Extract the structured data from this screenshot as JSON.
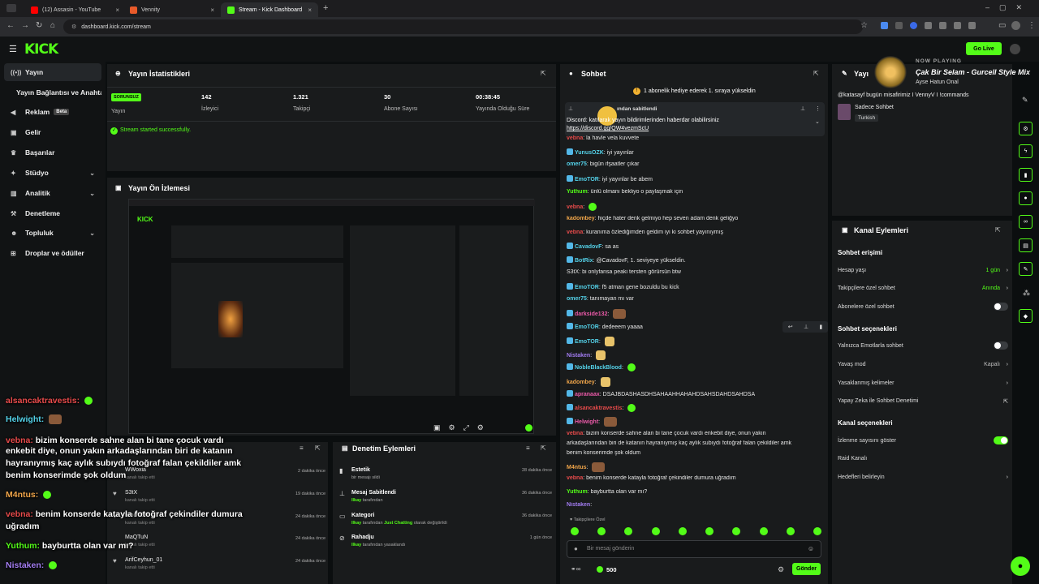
{
  "browser": {
    "tabs": [
      {
        "label": "(12) Assasin - YouTube",
        "color": "#ff0000"
      },
      {
        "label": "Vennity",
        "color": "#e85a2a"
      },
      {
        "label": "Stream - Kick Dashboard",
        "color": "#53fc18"
      }
    ],
    "url": "dashboard.kick.com/stream"
  },
  "nav": {
    "logo": "KICK",
    "golive": "Go Live"
  },
  "sidebar": {
    "items": [
      {
        "label": "Yayın",
        "icon": "broadcast-icon"
      },
      {
        "label": "Yayın Bağlantısı ve Anahtarı"
      },
      {
        "label": "Reklam",
        "badge": "Beta",
        "icon": "megaphone-icon"
      },
      {
        "label": "Gelir",
        "icon": "money-icon"
      },
      {
        "label": "Başarılar",
        "icon": "trophy-icon"
      },
      {
        "label": "Stüdyo",
        "icon": "studio-icon"
      },
      {
        "label": "Analitik",
        "icon": "chart-icon"
      },
      {
        "label": "Denetleme",
        "icon": "hammer-icon"
      },
      {
        "label": "Topluluk",
        "icon": "users-icon"
      },
      {
        "label": "Droplar ve ödüller",
        "icon": "gift-icon"
      }
    ]
  },
  "stats": {
    "title": "Yayın İstatistikleri",
    "badge": "SORUNSUZ",
    "items": [
      {
        "value": "",
        "label": "Yayın"
      },
      {
        "value": "142",
        "label": "İzleyici"
      },
      {
        "value": "1.321",
        "label": "Takipçi"
      },
      {
        "value": "30",
        "label": "Abone Sayısı"
      },
      {
        "value": "00:38:45",
        "label": "Yayında Olduğu Süre"
      }
    ],
    "success": "Stream started successfully."
  },
  "preview": {
    "title": "Yayın Ön İzlemesi"
  },
  "activity": {
    "rows": [
      {
        "name": "WWoxia",
        "sub": "kanalı takip etti",
        "time": "2 dakika önce"
      },
      {
        "name": "S3tX",
        "sub": "kanalı takip etti",
        "time": "19 dakika önce"
      },
      {
        "name": "EmoTOR",
        "sub": "kanalı takip etti",
        "time": "24 dakika önce"
      },
      {
        "name": "MaQTuN",
        "sub": "kanalı takip etti",
        "time": "24 dakika önce"
      },
      {
        "name": "ArifCeyhun_01",
        "sub": "kanalı takip etti",
        "time": "24 dakika önce"
      }
    ]
  },
  "moderation": {
    "title": "Denetim Eylemleri",
    "rows": [
      {
        "name": "Estetik",
        "sub": "bir mesajı sildi",
        "time": "28 dakika önce"
      },
      {
        "name": "Mesaj Sabitlendi",
        "by": "Ilkay",
        "sub": " tarafından",
        "time": "36 dakika önce"
      },
      {
        "name": "Kategori",
        "by": "Ilkay",
        "sub": " tarafından ",
        "cat": "Just Chatting",
        "sub2": " olarak değiştirildi",
        "time": "36 dakika önce"
      },
      {
        "name": "Rahadju",
        "by": "Ilkay",
        "sub": " tarafından yasaklandı",
        "time": "1 gün önce"
      }
    ]
  },
  "chat": {
    "title": "Sohbet",
    "gift_banner": "1 abonelik hediye ederek 1. sıraya yükseldin",
    "pinned_label": "ından sabitlendi",
    "pinned_text": "Discord: katılarak yayın bildirimlerinden haberdar olabilirsiniz",
    "pinned_link": "https://discord.gg/QW4vezmScU",
    "messages": [
      {
        "user": "vebna",
        "c": "u-r",
        "text": "la havle vela kuvvete"
      },
      {
        "user": "YunusOZK",
        "c": "u-c",
        "text": "iyi yayınlar"
      },
      {
        "user": "omer75",
        "c": "u-c",
        "text": "bigün ifşaatler çıkar"
      },
      {
        "user": "EmoTOR",
        "c": "u-c",
        "text": "iyi yayınlar be abem"
      },
      {
        "user": "Yuthum",
        "c": "u-g",
        "text": "ünlü olmanı bekliyo o paylaşmak için"
      },
      {
        "user": "vebna",
        "c": "u-r",
        "text": ""
      },
      {
        "user": "kadombey",
        "c": "u-o",
        "text": "hiçde hater denk gelmiyo hep seven adam denk geliğyo"
      },
      {
        "user": "vebna",
        "c": "u-r",
        "text": "kuranıma özlediğimden geldim iyi ki sohbet yayınıymış"
      },
      {
        "user": "CavadovF",
        "c": "u-c",
        "text": "sa as"
      },
      {
        "user": "BotRix",
        "c": "u-c",
        "text": "@CavadovF, 1. seviyeye yükseldin."
      },
      {
        "user": "S3tX",
        "c": "u-w",
        "text": "bi onlyfansa peaki tersten görürsün btw"
      },
      {
        "user": "EmoTOR",
        "c": "u-c",
        "text": "f5 atman gene bozuldu bu kick"
      },
      {
        "user": "omer75",
        "c": "u-c",
        "text": "tanımayan mı var"
      },
      {
        "user": "darkside132",
        "c": "u-pk",
        "text": ""
      },
      {
        "user": "EmoTOR",
        "c": "u-c",
        "text": "dedeeem yaaaa"
      },
      {
        "user": "EmoTOR",
        "c": "u-c",
        "text": ""
      },
      {
        "user": "Nistaken",
        "c": "u-p",
        "text": ""
      },
      {
        "user": "NobleBlackBlood",
        "c": "u-c",
        "text": ""
      },
      {
        "user": "kadombey",
        "c": "u-o",
        "text": ""
      },
      {
        "user": "apranaax",
        "c": "u-pk",
        "text": "DSAJBDASHASDHSAHAAHHAHAHDSAHSDAHDSAHDSA"
      },
      {
        "user": "alsancaktravestis",
        "c": "u-r",
        "text": ""
      },
      {
        "user": "Helwight",
        "c": "u-pk",
        "text": ""
      },
      {
        "user": "vebna",
        "c": "u-r",
        "text": "bizim konserde sahne alan bi tane çocuk vardı enkebit diye, onun yakın"
      },
      {
        "user": "",
        "c": "u-w",
        "text": "arkadaşlarından biri de katanın hayranıymış kaç aylık subıydı fotoğraf falan çekildiler amk"
      },
      {
        "user": "",
        "c": "u-w",
        "text": "benim konserimde şok oldum"
      },
      {
        "user": "M4ntus",
        "c": "u-o",
        "text": ""
      },
      {
        "user": "vebna",
        "c": "u-r",
        "text": "benim konserde katayla fotoğraf çekindiler dumura uğradım"
      },
      {
        "user": "Yuthum",
        "c": "u-g",
        "text": "bayburtta olan var mı?"
      },
      {
        "user": "Nistaken",
        "c": "u-p",
        "text": ""
      }
    ],
    "followers_only": "Takipçilere Özel",
    "input_placeholder": "Bir mesaj gönderin",
    "points": "500",
    "send": "Gönder"
  },
  "now_playing": {
    "label": "NOW PLAYING",
    "title": "Çak Bir Selam - Gurcell Style Mix",
    "artist": "Ayse Hatun Onal"
  },
  "stream_info": {
    "title": "Yayı",
    "desc": "@katasayf bugün misafirimiz I VennyV I !commands",
    "category": "Sadece Sohbet",
    "tag": "Turkish"
  },
  "channel": {
    "title": "Kanal Eylemleri",
    "chat_access": "Sohbet erişimi",
    "rows1": [
      {
        "label": "Hesap yaşı",
        "value": "1 gün"
      },
      {
        "label": "Takipçilere özel sohbet",
        "value": "Anında"
      },
      {
        "label": "Abonelere özel sohbet",
        "value": ""
      }
    ],
    "chat_options": "Sohbet seçenekleri",
    "rows2": [
      {
        "label": "Yalnızca Emotlarla sohbet",
        "value": ""
      },
      {
        "label": "Yavaş mod",
        "value": "Kapalı"
      },
      {
        "label": "Yasaklanmış kelimeler",
        "value": ""
      },
      {
        "label": "Yapay Zeka ile Sohbet Denetimi",
        "value": ""
      }
    ],
    "channel_options": "Kanal seçenekleri",
    "rows3": [
      {
        "label": "İzlenme sayısını göster",
        "value": ""
      },
      {
        "label": "Raid Kanalı",
        "value": ""
      },
      {
        "label": "Hedefleri belirleyin",
        "value": ""
      }
    ]
  },
  "overlay": [
    {
      "user": "alsancaktravestis",
      "c": "#e84b4b",
      "text": ""
    },
    {
      "user": "Helwight",
      "c": "#54d1e8",
      "text": ""
    },
    {
      "user": "vebna",
      "c": "#e84b4b",
      "text": "bizim konserde sahne alan bi tane çocuk vardı"
    },
    {
      "user": "",
      "c": "",
      "text": "enkebit diye, onun yakın arkadaşlarından biri de katanın"
    },
    {
      "user": "",
      "c": "",
      "text": "hayranıymış kaç aylık subıydı fotoğraf falan çekildiler amk"
    },
    {
      "user": "",
      "c": "",
      "text": "benim konserimde şok oldum"
    },
    {
      "user": "M4ntus",
      "c": "#f0a54a",
      "text": ""
    },
    {
      "user": "vebna",
      "c": "#e84b4b",
      "text": "benim konserde katayla fotoğraf çekindiler dumura"
    },
    {
      "user": "",
      "c": "",
      "text": "uğradım"
    },
    {
      "user": "Yuthum",
      "c": "#53fc18",
      "text": "bayburtta olan var mı?"
    },
    {
      "user": "Nistaken",
      "c": "#a27cf0",
      "text": ""
    }
  ]
}
